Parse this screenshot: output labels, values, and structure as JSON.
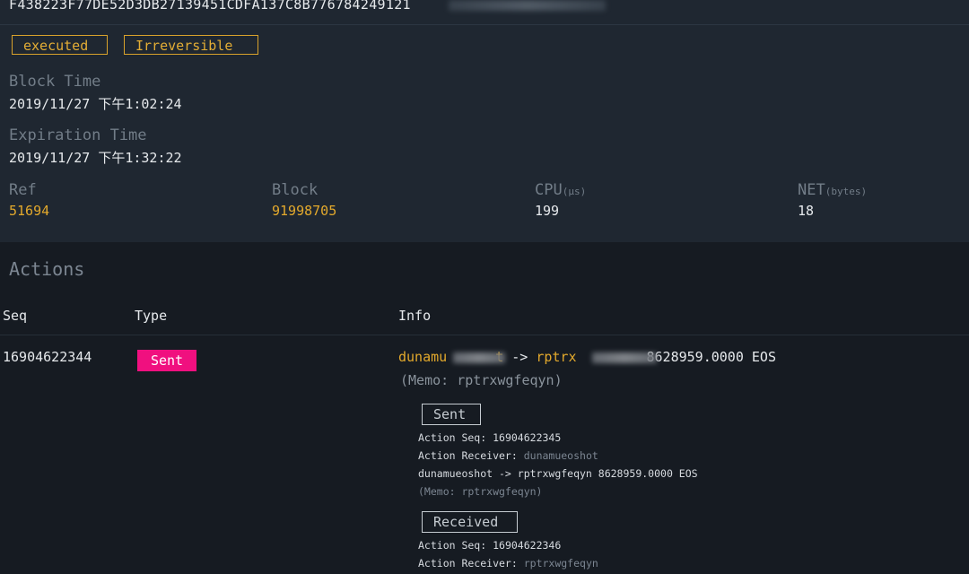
{
  "tx": {
    "hash": "F438223F77DE52D3DB27139451CDFA137C8B776784249121",
    "tags": {
      "executed": "executed",
      "irreversible": "Irreversible"
    },
    "block_time_label": "Block Time",
    "block_time_value": "2019/11/27 下午1:02:24",
    "expiration_label": "Expiration Time",
    "expiration_value": "2019/11/27 下午1:32:22",
    "ref_label": "Ref",
    "ref_value": "51694",
    "block_label": "Block",
    "block_value": "91998705",
    "cpu_label": "CPU",
    "cpu_unit": "(μs)",
    "cpu_value": "199",
    "net_label": "NET",
    "net_unit": "(bytes)",
    "net_value": "18"
  },
  "actions": {
    "title": "Actions",
    "columns": {
      "seq": "Seq",
      "type": "Type",
      "info": "Info"
    },
    "row": {
      "seq": "16904622344",
      "type": "Sent",
      "from": "dunamu",
      "from_tail": "t",
      "arrow": "->",
      "to": "rptrx",
      "amount": "8628959.0000 EOS",
      "memo": "(Memo: rptrxwgfeqyn)"
    },
    "sub_actions": [
      {
        "button": "Sent",
        "seq_label": "Action Seq:",
        "seq_value": "16904622345",
        "receiver_label": "Action Receiver:",
        "receiver_value": "dunamueoshot",
        "transfer": "dunamueoshot -> rptrxwgfeqyn 8628959.0000 EOS",
        "memo": "(Memo: rptrxwgfeqyn)"
      },
      {
        "button": "Received",
        "seq_label": "Action Seq:",
        "seq_value": "16904622346",
        "receiver_label": "Action Receiver:",
        "receiver_value": "rptrxwgfeqyn"
      }
    ]
  }
}
